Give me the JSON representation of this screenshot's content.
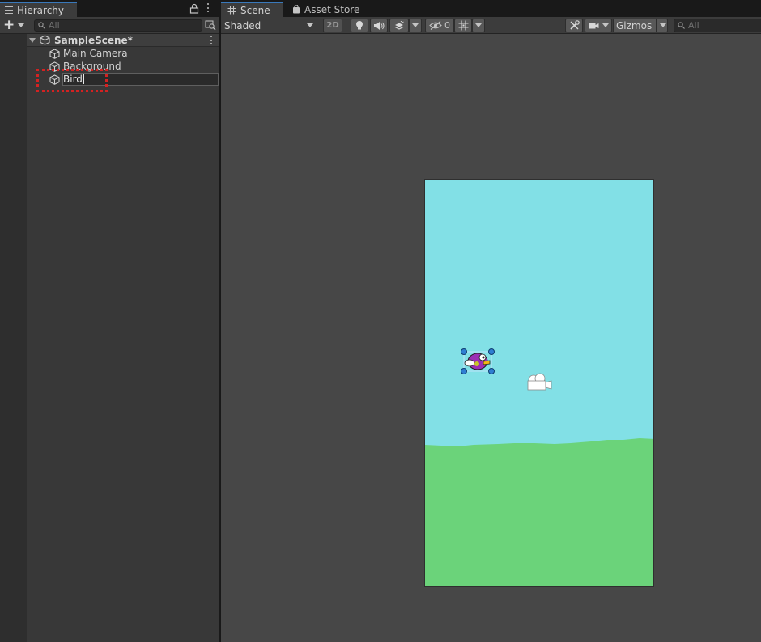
{
  "hierarchy": {
    "tab_label": "Hierarchy",
    "search_placeholder": "All",
    "scene": {
      "name": "SampleScene*",
      "objects": [
        {
          "name": "Main Camera"
        },
        {
          "name": "Background"
        }
      ],
      "renaming": {
        "value": "Bird"
      }
    }
  },
  "scene_view": {
    "tabs": [
      {
        "label": "Scene"
      },
      {
        "label": "Asset Store"
      }
    ],
    "toolbar": {
      "shading_mode": "Shaded",
      "mode_2d_label": "2D",
      "hidden_count": "0",
      "gizmos_label": "Gizmos",
      "search_placeholder": "All"
    }
  },
  "colors": {
    "accent": "#3a79bb",
    "sky": "#82e0e6",
    "ground": "#6bd37a",
    "highlight": "#d32222",
    "bird_body": "#9b2fb5",
    "bird_beak": "#f2b414"
  }
}
